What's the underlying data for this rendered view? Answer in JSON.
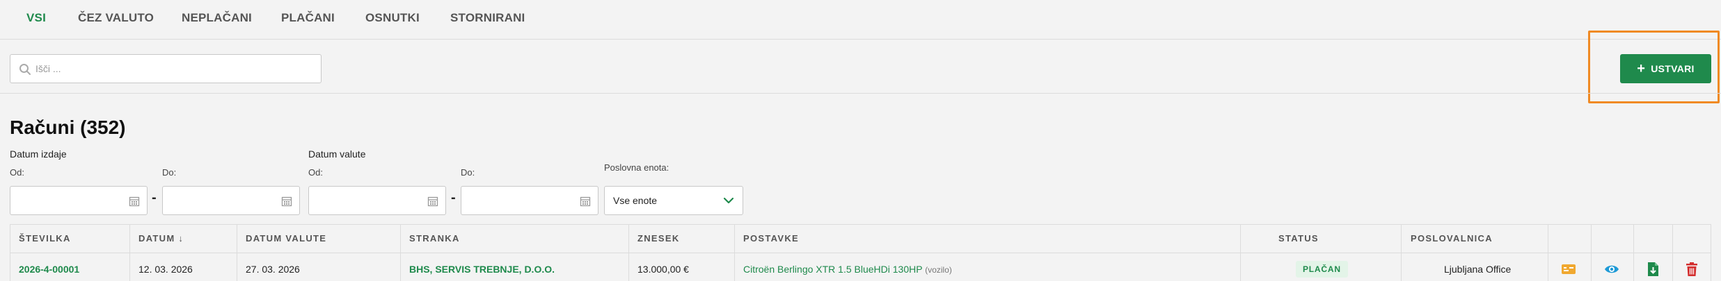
{
  "tabs": [
    {
      "label": "VSI",
      "active": true
    },
    {
      "label": "ČEZ VALUTO"
    },
    {
      "label": "NEPLAČANI"
    },
    {
      "label": "PLAČANI"
    },
    {
      "label": "OSNUTKI"
    },
    {
      "label": "STORNIRANI"
    }
  ],
  "search": {
    "placeholder": "Išči ..."
  },
  "create_button": {
    "label": "USTVARI"
  },
  "page_title": "Računi (352)",
  "filters": {
    "issue_date_label": "Datum izdaje",
    "due_date_label": "Datum valute",
    "from_label": "Od:",
    "to_label": "Do:",
    "unit_label": "Poslovna enota:",
    "unit_value": "Vse enote"
  },
  "table": {
    "headers": [
      "ŠTEVILKA",
      "DATUM ↓",
      "DATUM VALUTE",
      "STRANKA",
      "ZNESEK",
      "POSTAVKE",
      "STATUS",
      "POSLOVALNICA"
    ],
    "rows": [
      {
        "number": "2026-4-00001",
        "date": "12. 03. 2026",
        "due_date": "27. 03. 2026",
        "customer": "BHS, SERVIS TREBNJE, D.O.O.",
        "amount": "13.000,00 €",
        "item": "Citroën Berlingo XTR 1.5 BlueHDi 130HP",
        "item_note": "(vozilo)",
        "status": "PLAČAN",
        "branch": "Ljubljana Office"
      }
    ]
  },
  "colors": {
    "accent": "#1f8a4c",
    "highlight": "#f08a24",
    "danger": "#d32f2f",
    "info": "#1e9ad6",
    "warning": "#f0a830"
  }
}
